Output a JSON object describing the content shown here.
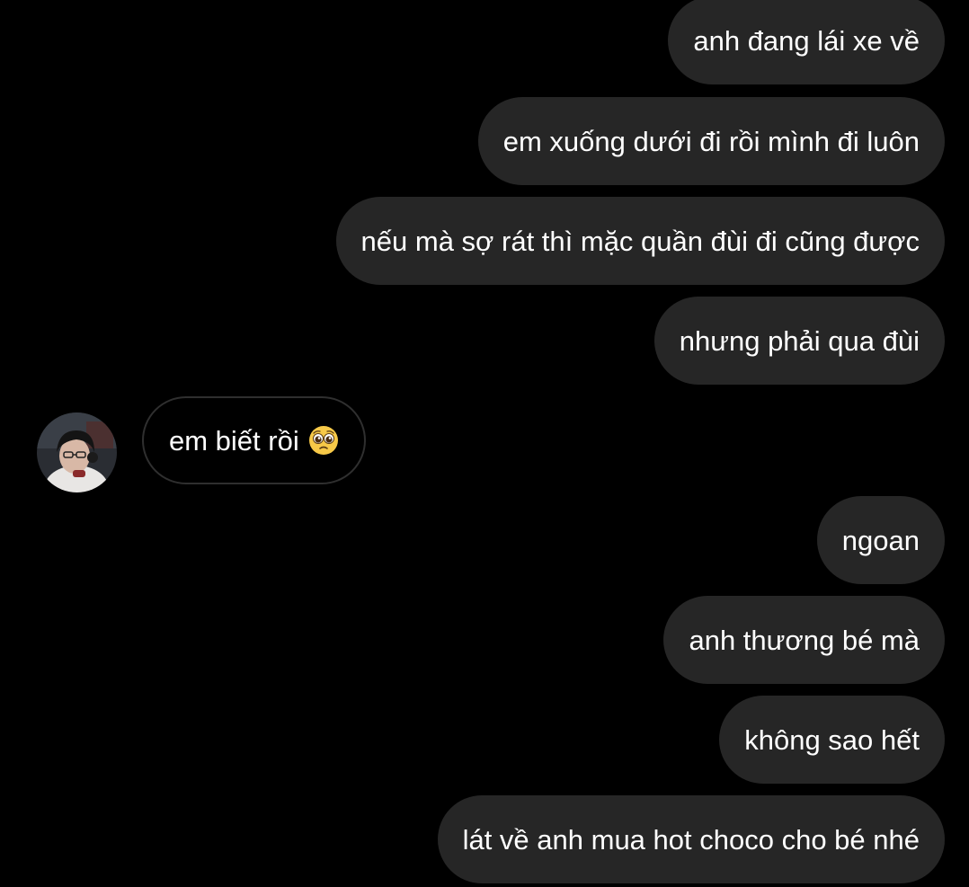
{
  "thread": {
    "messages": [
      {
        "sender": "me",
        "text": "anh đang lái xe về"
      },
      {
        "sender": "me",
        "text": "em xuống dưới đi rồi mình đi luôn"
      },
      {
        "sender": "me",
        "text": "nếu mà sợ rát thì mặc quần đùi đi cũng được"
      },
      {
        "sender": "me",
        "text": "nhưng phải qua đùi"
      },
      {
        "sender": "them",
        "text": "em biết rồi",
        "emoji": "pleading-face-icon"
      },
      {
        "sender": "me",
        "text": "ngoan"
      },
      {
        "sender": "me",
        "text": "anh thương bé mà"
      },
      {
        "sender": "me",
        "text": "không sao hết "
      },
      {
        "sender": "me",
        "text": "lát về anh mua hot choco cho bé nhé"
      }
    ]
  },
  "colors": {
    "background": "#000000",
    "sent_bubble": "#262626",
    "received_bubble_border": "#2f2f2f",
    "text": "#ffffff"
  }
}
